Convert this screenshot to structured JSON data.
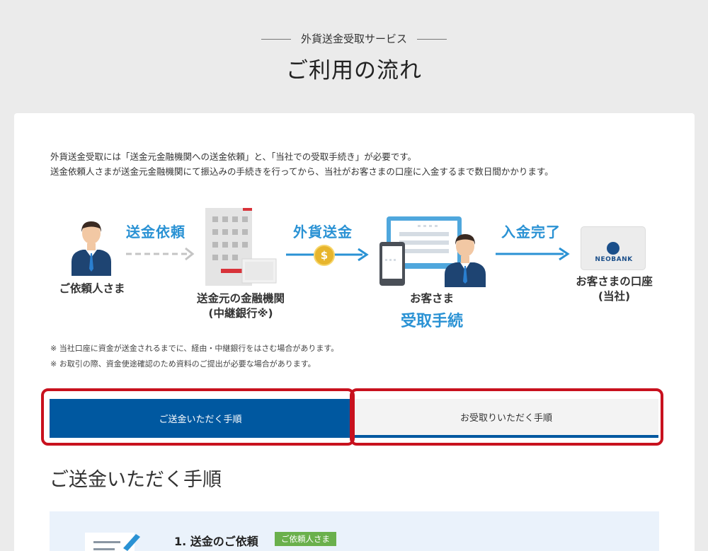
{
  "header": {
    "subtitle": "外貨送金受取サービス",
    "title": "ご利用の流れ"
  },
  "intro": {
    "line1": "外貨送金受取には「送金元金融機関への送金依頼」と、「当社での受取手続き」が必要です。",
    "line2": "送金依頼人さまが送金元金融機関にて振込みの手続きを行ってから、当社がお客さまの口座に入金するまで数日間かかります。"
  },
  "flow": {
    "steps": [
      "送金依頼",
      "外貨送金",
      "入金完了"
    ],
    "nodes": {
      "requester": "ご依頼人さま",
      "sender_bank_line1": "送金元の金融機関",
      "sender_bank_line2": "(中継銀行※)",
      "customer": "お客さま",
      "customer_action": "受取手続",
      "account_line1": "お客さまの口座",
      "account_line2": "(当社)"
    },
    "bank_card_logo": "NEOBANK",
    "coin_symbol": "$"
  },
  "notes": [
    "※ 当社口座に資金が送金されるまでに、経由・中継銀行をはさむ場合があります。",
    "※ お取引の際、資金使途確認のため資料のご提出が必要な場合があります。"
  ],
  "tabs": {
    "send": "ご送金いただく手順",
    "receive": "お受取りいただく手順"
  },
  "section": {
    "title": "ご送金いただく手順"
  },
  "procedure": {
    "step1_title": "1. 送金のご依頼",
    "step1_badge": "ご依頼人さま"
  },
  "colors": {
    "accent_blue": "#0058a0",
    "step_blue": "#2a92d4",
    "highlight_red": "#c8111e",
    "badge_green": "#6ab04c"
  }
}
